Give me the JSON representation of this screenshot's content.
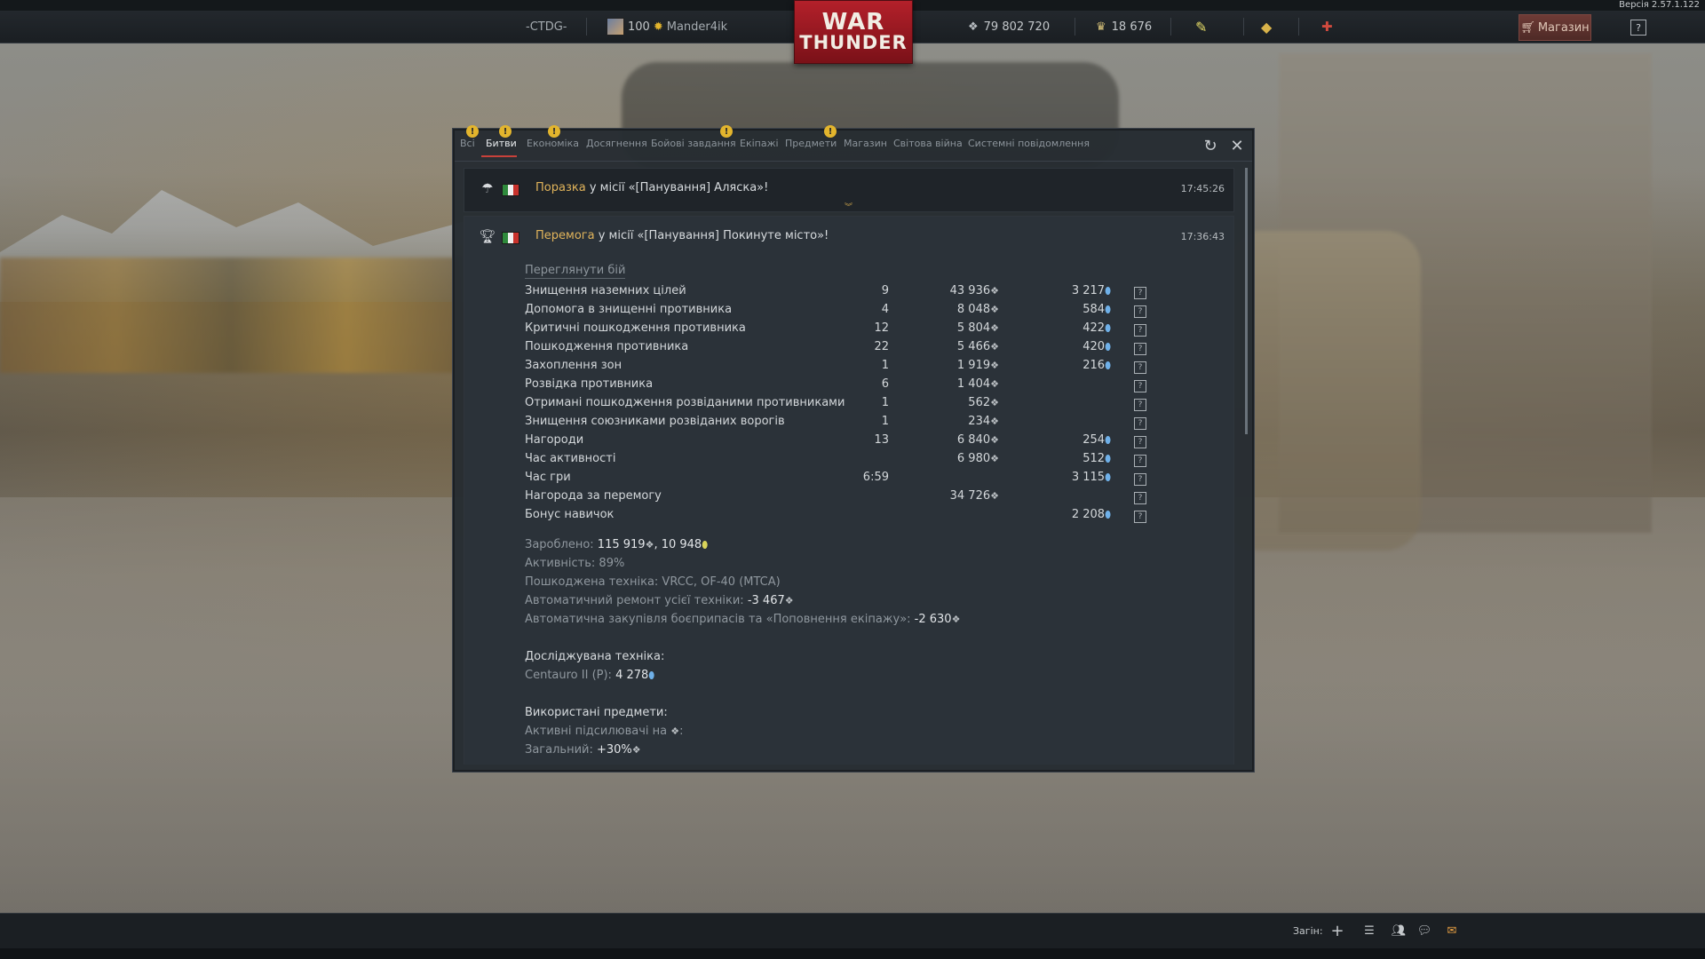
{
  "version": "Версія 2.57.1.122",
  "topbar": {
    "clan_tag": "-CTDG-",
    "level": "100",
    "player_name": "Mander4ik",
    "silver_lions": "79 802 720",
    "golden_eagles": "18 676",
    "logo_line1": "WAR",
    "logo_line2": "THUNDER",
    "shop_label": "Магазин",
    "help_label": "?"
  },
  "tabs": [
    {
      "label": "Всі",
      "warn": true
    },
    {
      "label": "Битви",
      "warn": true,
      "active": true
    },
    {
      "label": "Економіка",
      "warn": true
    },
    {
      "label": "Досягнення",
      "warn": false
    },
    {
      "label": "Бойові завдання",
      "warn": true
    },
    {
      "label": "Екіпажі",
      "warn": false
    },
    {
      "label": "Предмети",
      "warn": true
    },
    {
      "label": "Магазин",
      "warn": false
    },
    {
      "label": "Світова війна",
      "warn": false
    },
    {
      "label": "Системні повідомлення",
      "warn": false
    }
  ],
  "messages": [
    {
      "result": "Поразка",
      "text": " у місії «[Панування] Аляска»!",
      "time": "17:45:26"
    },
    {
      "result": "Перемога",
      "text": " у місії «[Панування] Покинуте місто»!",
      "time": "17:36:43"
    }
  ],
  "replay_link": "Переглянути бій",
  "rows": [
    {
      "name": "Знищення наземних цілей",
      "count": "9",
      "sl": "43 936",
      "rp": "3 217"
    },
    {
      "name": "Допомога в знищенні противника",
      "count": "4",
      "sl": "8 048",
      "rp": "584"
    },
    {
      "name": "Критичні пошкодження противника",
      "count": "12",
      "sl": "5 804",
      "rp": "422"
    },
    {
      "name": "Пошкодження противника",
      "count": "22",
      "sl": "5 466",
      "rp": "420"
    },
    {
      "name": "Захоплення зон",
      "count": "1",
      "sl": "1 919",
      "rp": "216"
    },
    {
      "name": "Розвідка противника",
      "count": "6",
      "sl": "1 404",
      "rp": ""
    },
    {
      "name": "Отримані пошкодження розвіданими противниками",
      "count": "1",
      "sl": "562",
      "rp": ""
    },
    {
      "name": "Знищення союзниками розвіданих ворогів",
      "count": "1",
      "sl": "234",
      "rp": ""
    },
    {
      "name": "Нагороди",
      "count": "13",
      "sl": "6 840",
      "rp": "254"
    },
    {
      "name": "Час активності",
      "count": "",
      "sl": "6 980",
      "rp": "512"
    },
    {
      "name": "Час гри",
      "count": "6:59",
      "sl": "",
      "rp": "3 115"
    },
    {
      "name": "Нагорода за перемогу",
      "count": "",
      "sl": "34 726",
      "rp": ""
    },
    {
      "name": "Бонус навичок",
      "count": "",
      "sl": "",
      "rp": "2 208"
    }
  ],
  "summary": {
    "earned_label": "Зароблено: ",
    "earned_sl": "115 919",
    "earned_rp": "10 948",
    "activity": "Активність: 89%",
    "damaged_vehicles": "Пошкоджена техніка: VRCC, OF-40 (MTCA)",
    "repair_label": "Автоматичний ремонт усієї техніки: ",
    "repair_value": "-3 467",
    "purchase_label": "Автоматична закупівля боєприпасів та «Поповнення екіпажу»: ",
    "purchase_value": "-2 630",
    "researched_title": "Досліджувана техніка:",
    "researched_label": "Centauro II (P): ",
    "researched_value": "4 278",
    "used_items_title": "Використані предмети:",
    "boosters_label": "Активні підсилювачі на ",
    "general_label": "Загальний: ",
    "general_value": "+30%"
  },
  "bottombar": {
    "squad_label": "Загін:"
  },
  "colors": {
    "result_accent": "#e1b45b",
    "tab_underline": "#c8413a",
    "warn": "#e3b52d",
    "rp_icon": "#6fb0e8",
    "shop_button": "#6e3b36"
  }
}
